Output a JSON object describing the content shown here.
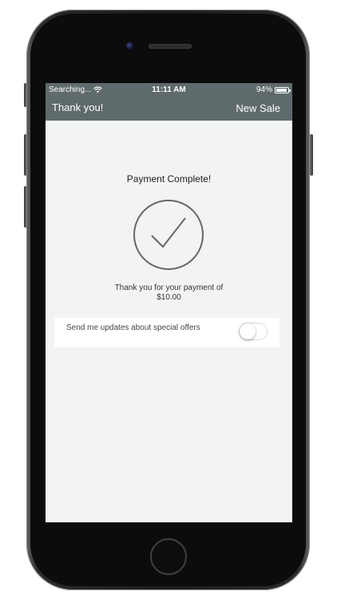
{
  "status_bar": {
    "carrier": "Searching...",
    "time": "11:11 AM",
    "battery_percent": "94%",
    "battery_level": 0.94
  },
  "nav_bar": {
    "title": "Thank you!",
    "action_label": "New Sale"
  },
  "content": {
    "headline": "Payment Complete!",
    "message_line1": "Thank you for your payment of",
    "message_line2": "$10.00",
    "option_label": "Send me updates about special offers",
    "option_enabled": false
  },
  "colors": {
    "nav_background": "#5f6a6c",
    "screen_background": "#f2f3f5",
    "check_stroke": "#666666"
  }
}
